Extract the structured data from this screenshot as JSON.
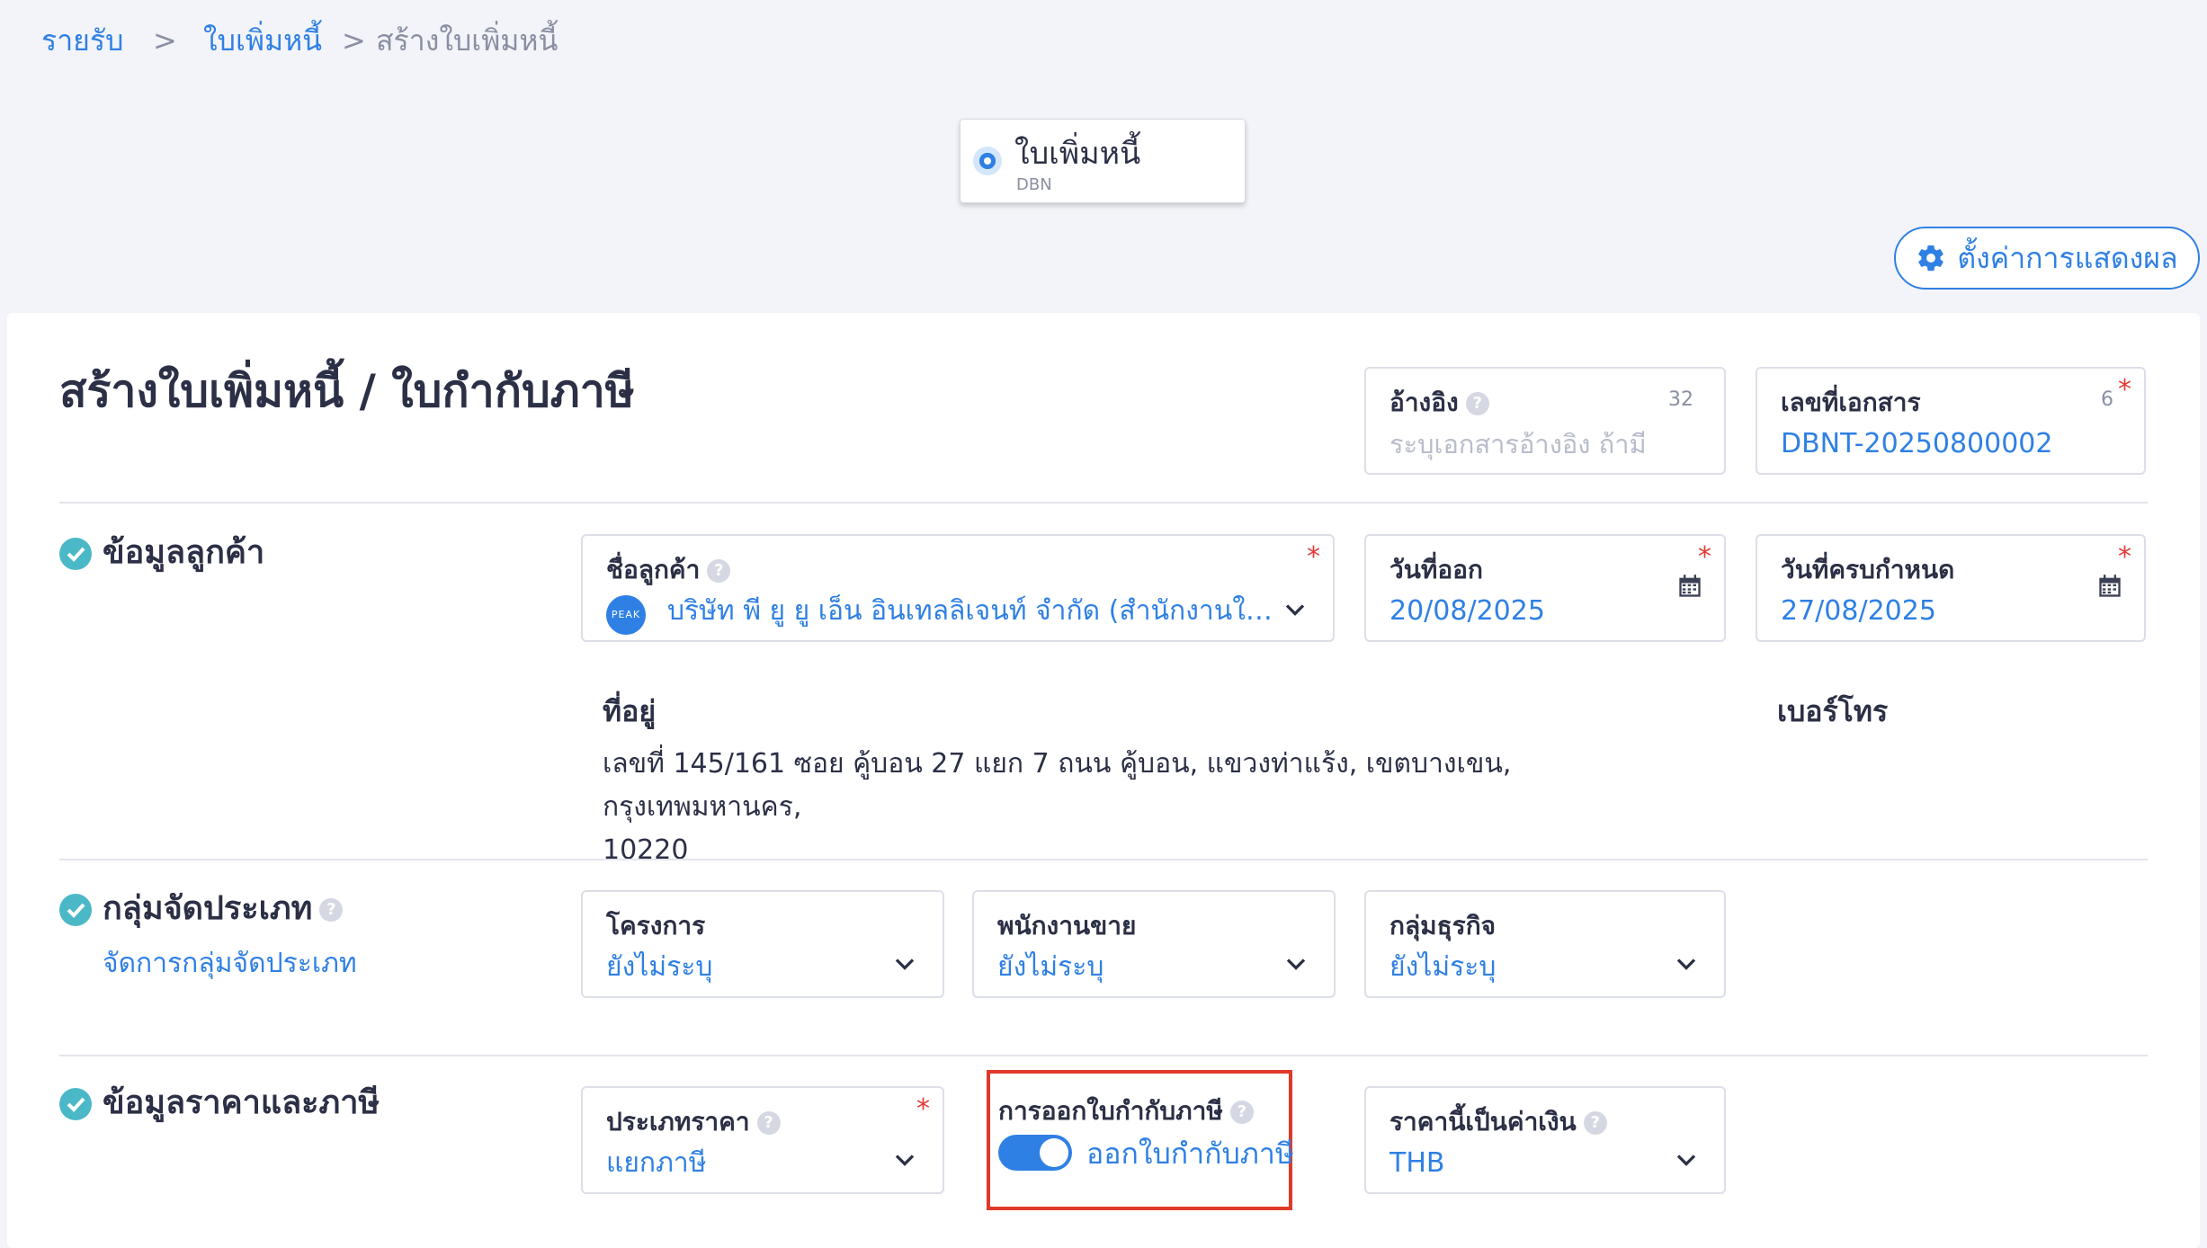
{
  "breadcrumb": {
    "items": [
      "รายรับ",
      "ใบเพิ่มหนี้"
    ],
    "separator": ">",
    "current": "สร้างใบเพิ่มหนี้"
  },
  "doc_type": {
    "title": "ใบเพิ่มหนี้",
    "code": "DBN"
  },
  "settings_button": {
    "label": "ตั้งค่าการแสดงผล",
    "icon": "gear-icon"
  },
  "page_title": "สร้างใบเพิ่มหนี้ / ใบกำกับภาษี",
  "reference": {
    "label": "อ้างอิง",
    "placeholder": "ระบุเอกสารอ้างอิง ถ้ามี",
    "max_length": "32"
  },
  "doc_number": {
    "label": "เลขที่เอกสาร",
    "value": "DBNT-20250800002",
    "max_length": "6",
    "required_mark": "*"
  },
  "customer_section": {
    "title": "ข้อมูลลูกค้า",
    "customer": {
      "label": "ชื่อลูกค้า",
      "value": "บริษัท พี ยู ยู เอ็น อินเทลลิเจนท์ จำกัด (สำนักงานให...",
      "logo_text": "PEAK",
      "required_mark": "*"
    },
    "issue_date": {
      "label": "วันที่ออก",
      "value": "20/08/2025",
      "required_mark": "*"
    },
    "due_date": {
      "label": "วันที่ครบกำหนด",
      "value": "27/08/2025",
      "required_mark": "*"
    },
    "address_label": "ที่อยู่",
    "address_line1": "เลขที่ 145/161 ซอย คู้บอน 27 แยก 7 ถนน คู้บอน, แขวงท่าแร้ง, เขตบางเขน, กรุงเทพมหานคร,",
    "address_line2": "10220",
    "phone_label": "เบอร์โทร"
  },
  "category_section": {
    "title": "กลุ่มจัดประเภท",
    "manage_link": "จัดการกลุ่มจัดประเภท",
    "project": {
      "label": "โครงการ",
      "value": "ยังไม่ระบุ"
    },
    "salesperson": {
      "label": "พนักงานขาย",
      "value": "ยังไม่ระบุ"
    },
    "business_group": {
      "label": "กลุ่มธุรกิจ",
      "value": "ยังไม่ระบุ"
    }
  },
  "price_section": {
    "title": "ข้อมูลราคาและภาษี",
    "price_type": {
      "label": "ประเภทราคา",
      "value": "แยกภาษี",
      "required_mark": "*"
    },
    "tax_invoice": {
      "label": "การออกใบกำกับภาษี",
      "toggle_text": "ออกใบกำกับภาษี",
      "enabled": true
    },
    "currency": {
      "label": "ราคานี้เป็นค่าเงิน",
      "value": "THB"
    }
  },
  "colors": {
    "accent": "#2f80e4",
    "check": "#4bb8c8",
    "required": "#e53935",
    "highlight": "#e0392a"
  }
}
